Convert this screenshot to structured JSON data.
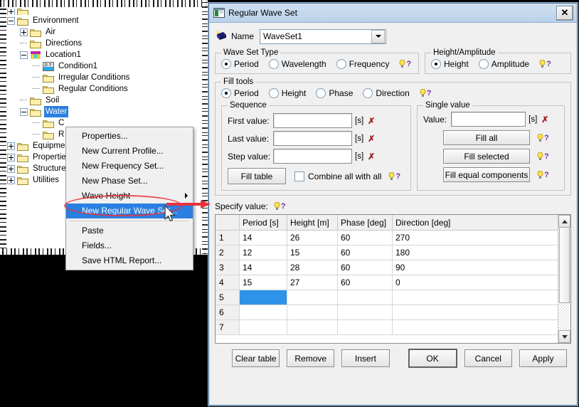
{
  "tree": {
    "items": [
      {
        "label": "",
        "depth": 0,
        "toggle": "plus",
        "icon": "folder-icon",
        "selected": false,
        "clipped": true
      },
      {
        "label": "Environment",
        "depth": 0,
        "toggle": "minus",
        "icon": "folder-icon",
        "selected": false
      },
      {
        "label": "Air",
        "depth": 1,
        "toggle": "plus",
        "icon": "folder-icon",
        "selected": false
      },
      {
        "label": "Directions",
        "depth": 1,
        "toggle": "none",
        "icon": "folder-icon",
        "selected": false
      },
      {
        "label": "Location1",
        "depth": 1,
        "toggle": "minus",
        "icon": "location-icon",
        "selected": false
      },
      {
        "label": "Condition1",
        "depth": 2,
        "toggle": "none",
        "icon": "condition-icon",
        "selected": false
      },
      {
        "label": "Irregular Conditions",
        "depth": 2,
        "toggle": "none",
        "icon": "folder-icon",
        "selected": false
      },
      {
        "label": "Regular Conditions",
        "depth": 2,
        "toggle": "none",
        "icon": "folder-icon",
        "selected": false
      },
      {
        "label": "Soil",
        "depth": 1,
        "toggle": "none",
        "icon": "folder-icon",
        "selected": false
      },
      {
        "label": "Water",
        "depth": 1,
        "toggle": "minus",
        "icon": "folder-icon",
        "selected": true
      },
      {
        "label": "C",
        "depth": 2,
        "toggle": "none",
        "icon": "folder-icon",
        "selected": false
      },
      {
        "label": "R",
        "depth": 2,
        "toggle": "none",
        "icon": "folder-icon",
        "selected": false
      },
      {
        "label": "Equipment",
        "depth": 0,
        "toggle": "plus",
        "icon": "folder-icon",
        "selected": false
      },
      {
        "label": "Properties",
        "depth": 0,
        "toggle": "plus",
        "icon": "folder-icon",
        "selected": false
      },
      {
        "label": "Structure",
        "depth": 0,
        "toggle": "plus",
        "icon": "folder-icon",
        "selected": false
      },
      {
        "label": "Utilities",
        "depth": 0,
        "toggle": "plus",
        "icon": "folder-icon",
        "selected": false
      }
    ]
  },
  "context_menu": {
    "items": [
      {
        "label": "Properties...",
        "highlighted": false,
        "submenu": false
      },
      {
        "label": "New Current Profile...",
        "highlighted": false,
        "submenu": false
      },
      {
        "label": "New Frequency Set...",
        "highlighted": false,
        "submenu": false
      },
      {
        "label": "New Phase Set...",
        "highlighted": false,
        "submenu": false
      },
      {
        "label": "Wave Height",
        "highlighted": false,
        "submenu": true
      },
      {
        "label": "New Regular Wave Set...",
        "highlighted": true,
        "submenu": false
      },
      {
        "label": "Paste",
        "highlighted": false,
        "submenu": false
      },
      {
        "label": "Fields...",
        "highlighted": false,
        "submenu": false
      },
      {
        "label": "Save HTML Report...",
        "highlighted": false,
        "submenu": false
      }
    ]
  },
  "dialog": {
    "title": "Regular Wave Set",
    "close_label": "✕",
    "name": {
      "label": "Name",
      "value": "WaveSet1",
      "placeholder": ""
    },
    "wave_set_type": {
      "legend": "Wave Set Type",
      "options": [
        {
          "label": "Period",
          "selected": true
        },
        {
          "label": "Wavelength",
          "selected": false
        },
        {
          "label": "Frequency",
          "selected": false
        }
      ]
    },
    "height_amplitude": {
      "legend": "Height/Amplitude",
      "options": [
        {
          "label": "Height",
          "selected": true
        },
        {
          "label": "Amplitude",
          "selected": false
        }
      ]
    },
    "fill_tools": {
      "legend": "Fill tools",
      "options": [
        {
          "label": "Period",
          "selected": true
        },
        {
          "label": "Height",
          "selected": false
        },
        {
          "label": "Phase",
          "selected": false
        },
        {
          "label": "Direction",
          "selected": false
        }
      ]
    },
    "sequence": {
      "legend": "Sequence",
      "fields": [
        {
          "label": "First value:",
          "value": "",
          "unit": "[s]"
        },
        {
          "label": "Last value:",
          "value": "",
          "unit": "[s]"
        },
        {
          "label": "Step value:",
          "value": "",
          "unit": "[s]"
        }
      ],
      "fill_table_label": "Fill table",
      "combine_label": "Combine all with all",
      "combine_checked": false
    },
    "single_value": {
      "legend": "Single value",
      "value_label": "Value:",
      "value": "",
      "unit": "[s]",
      "buttons": [
        "Fill all",
        "Fill selected",
        "Fill equal components"
      ]
    },
    "specify_value_label": "Specify value:",
    "table": {
      "columns": [
        "",
        "Period [s]",
        "Height [m]",
        "Phase [deg]",
        "Direction [deg]"
      ],
      "rows": [
        {
          "n": "1",
          "cells": [
            "14",
            "26",
            "60",
            "270"
          ]
        },
        {
          "n": "2",
          "cells": [
            "12",
            "15",
            "60",
            "180"
          ]
        },
        {
          "n": "3",
          "cells": [
            "14",
            "28",
            "60",
            "90"
          ]
        },
        {
          "n": "4",
          "cells": [
            "15",
            "27",
            "60",
            "0"
          ]
        },
        {
          "n": "5",
          "cells": [
            "",
            "",
            "",
            ""
          ],
          "selected_cell": 0
        },
        {
          "n": "6",
          "cells": [
            "",
            "",
            "",
            ""
          ]
        },
        {
          "n": "7",
          "cells": [
            "",
            "",
            "",
            ""
          ]
        }
      ]
    },
    "footer_buttons": [
      {
        "label": "Clear table",
        "default": false
      },
      {
        "label": "Remove",
        "default": false
      },
      {
        "label": "Insert",
        "default": false
      },
      {
        "label": "OK",
        "default": true
      },
      {
        "label": "Cancel",
        "default": false
      },
      {
        "label": "Apply",
        "default": false
      }
    ]
  },
  "colors": {
    "selection_blue": "#2a7fe0",
    "cell_selection": "#2e92e8",
    "annotation_red": "#e8323c",
    "titlebar": "#b9d2ea",
    "folder_yellow": "#f5e08c"
  }
}
